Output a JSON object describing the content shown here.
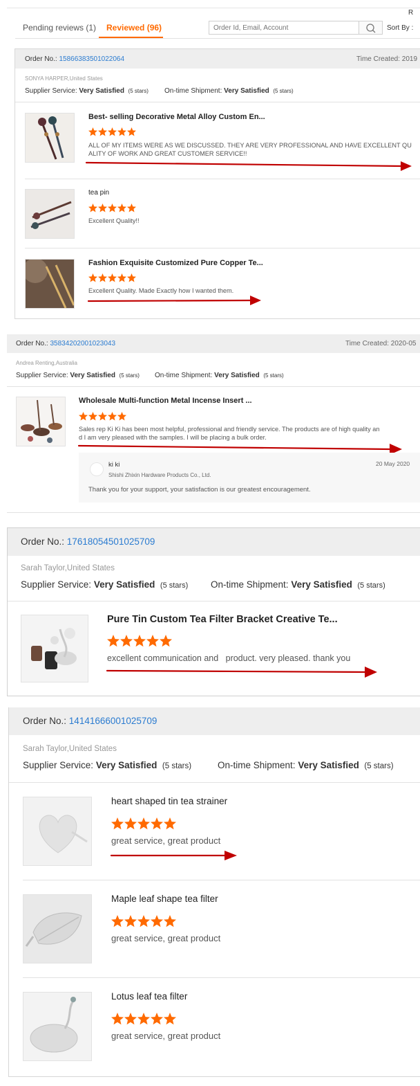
{
  "top": {
    "corner_letter": "R",
    "tabs": [
      {
        "label": "Pending reviews (1)"
      },
      {
        "label": "Reviewed (96)"
      }
    ],
    "search": {
      "placeholder": "Order Id, Email, Account"
    },
    "sort_label": "Sort By :"
  },
  "orders": [
    {
      "order_label": "Order No.:",
      "order_no": "15866383501022064",
      "time_label": "Time Created: 2019",
      "buyer": "SONYA HARPER,United States",
      "supplier_label": "Supplier Service:",
      "supplier_value": "Very Satisfied",
      "supplier_stars": "(5 stars)",
      "shipment_label": "On-time Shipment:",
      "shipment_value": "Very Satisfied",
      "shipment_stars": "(5 stars)",
      "items": [
        {
          "title": "Best- selling Decorative Metal Alloy Custom En...",
          "rating": 5,
          "review_line1": "ALL OF MY ITEMS WERE AS WE DISCUSSED. THEY ARE VERY PROFESSIONAL AND HAVE EXCELLENT QU",
          "review_line2": "ALITY OF WORK AND GREAT CUSTOMER SERVICE!!"
        },
        {
          "title": "tea pin",
          "rating": 5,
          "review_line1": "Excellent Quality!!"
        },
        {
          "title": "Fashion Exquisite Customized Pure Copper Te...",
          "rating": 5,
          "review_line1": "Excellent Quality.  Made Exactly how I wanted them."
        }
      ]
    },
    {
      "order_label": "Order No.:",
      "order_no": "35834202001023043",
      "time_label": "Time Created: 2020-05",
      "buyer": "Andrea Renting,Australia",
      "supplier_label": "Supplier Service:",
      "supplier_value": "Very Satisfied",
      "supplier_stars": "(5 stars)",
      "shipment_label": "On-time Shipment:",
      "shipment_value": "Very Satisfied",
      "shipment_stars": "(5 stars)",
      "items": [
        {
          "title": "Wholesale Multi-function Metal Incense Insert ...",
          "rating": 5,
          "review_line1": "Sales rep Ki Ki has been most helpful, professional and friendly service. The products are of high quality an",
          "review_line2": "d I am very pleased with the samples. I will be placing a bulk order."
        }
      ],
      "reply": {
        "name": "ki ki",
        "company": "Shishi Zhixin Hardware Products Co., Ltd.",
        "date": "20 May 2020",
        "text": "Thank you for your support, your satisfaction is our greatest encouragement."
      }
    },
    {
      "order_label": "Order No.:",
      "order_no": "17618054501025709",
      "buyer": "Sarah Taylor,United States",
      "supplier_label": "Supplier Service:",
      "supplier_value": "Very Satisfied",
      "supplier_stars": "(5 stars)",
      "shipment_label": "On-time Shipment:",
      "shipment_value": "Very Satisfied",
      "shipment_stars": "(5 stars)",
      "items": [
        {
          "title": "Pure Tin Custom Tea Filter Bracket Creative Te...",
          "rating": 5,
          "review_line1": "excellent communication and   product. very pleased. thank you"
        }
      ]
    },
    {
      "order_label": "Order No.:",
      "order_no": "14141666001025709",
      "buyer": "Sarah Taylor,United States",
      "supplier_label": "Supplier Service:",
      "supplier_value": "Very Satisfied",
      "supplier_stars": "(5 stars)",
      "shipment_label": "On-time Shipment:",
      "shipment_value": "Very Satisfied",
      "shipment_stars": "(5 stars)",
      "items": [
        {
          "title": "heart shaped tin tea strainer",
          "rating": 5,
          "review_line1": "great service, great product"
        },
        {
          "title": "Maple leaf shape tea filter",
          "rating": 5,
          "review_line1": "great service, great product"
        },
        {
          "title": "Lotus leaf tea filter",
          "rating": 5,
          "review_line1": "great service, great product"
        }
      ]
    }
  ],
  "colors": {
    "accent": "#ff6a00",
    "link": "#2a7bd0",
    "annotation_arrow": "#c00000",
    "header_bg": "#eeeeee"
  }
}
